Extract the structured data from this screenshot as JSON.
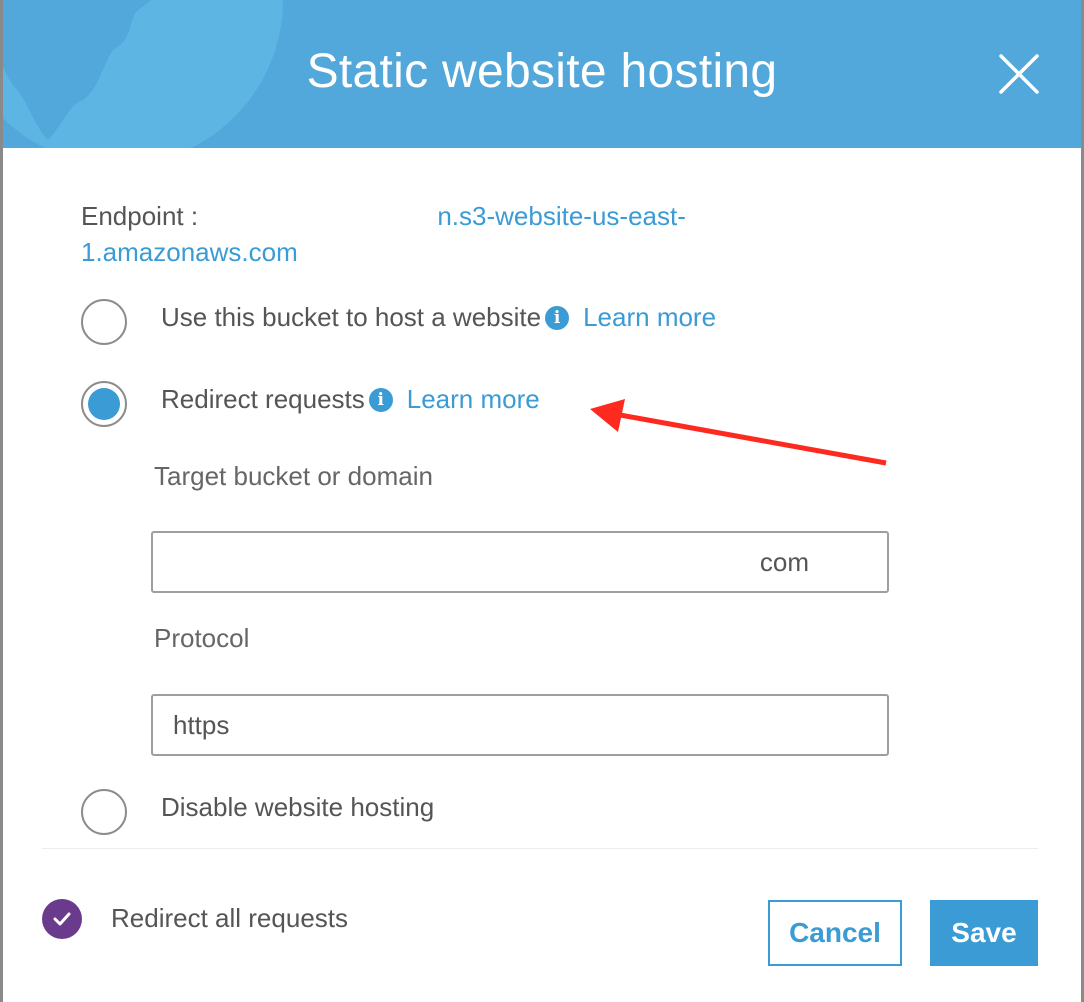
{
  "dialog": {
    "title": "Static website hosting",
    "close_icon": "close-icon"
  },
  "endpoint": {
    "label": "Endpoint :",
    "url_visible_part_1": "n.s3-website-us-east-",
    "url_visible_part_2": "1.amazonaws.com"
  },
  "options": [
    {
      "label": "Use this bucket to host a website",
      "learn_more": "Learn more",
      "checked": false,
      "info_glyph": "i"
    },
    {
      "label": "Redirect requests",
      "learn_more": "Learn more",
      "checked": true,
      "info_glyph": "i"
    },
    {
      "label": "Disable website hosting",
      "checked": false
    }
  ],
  "redirect": {
    "target_label": "Target bucket or domain",
    "target_value": "com",
    "protocol_label": "Protocol",
    "protocol_value": "https"
  },
  "footer": {
    "status_label": "Redirect all requests",
    "cancel_label": "Cancel",
    "save_label": "Save"
  },
  "colors": {
    "header": "#52a8da",
    "accent": "#3a9bd5",
    "status_badge": "#6a3b8c",
    "annotation_arrow": "#ff2a1f"
  }
}
